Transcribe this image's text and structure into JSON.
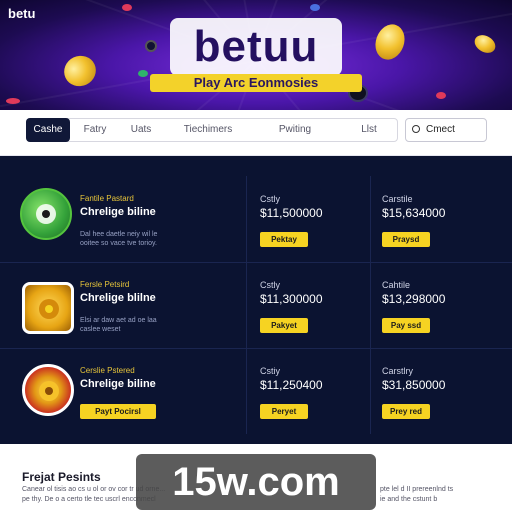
{
  "hero": {
    "corner_logo": "betu",
    "logo": "betuu",
    "tagline": "Play Arc Eonmosies"
  },
  "nav": {
    "tabs": [
      "Cashe",
      "Fatry",
      "Uats",
      "Tiechimers",
      "Pwiting",
      "Llst"
    ],
    "active_index": 0,
    "contact_label": "Cmect",
    "contact_icon": "search-icon"
  },
  "games": [
    {
      "icon": "frog-mascot-icon",
      "category": "Fantile Pastard",
      "title": "Chrelige biline",
      "description": "Dal hee daetle neiy wil le ooitee so vace tve torioy.",
      "stat1_label": "Cstly",
      "stat1_value": "$11,500000",
      "button1": "Pektay",
      "stat2_label": "Carstile",
      "stat2_value": "$15,634000",
      "button2": "Praysd"
    },
    {
      "icon": "gold-coin-emblem-icon",
      "category": "Fersle Petsird",
      "title": "Chrelige blilne",
      "description": "Elsi ar daw aet ad oe laa caslee weset",
      "stat1_label": "Cstly",
      "stat1_value": "$11,300000",
      "button1": "Pakyet",
      "stat2_label": "Cahtile",
      "stat2_value": "$13,298000",
      "button2": "Pay ssd"
    },
    {
      "icon": "red-coin-emblem-icon",
      "category": "Cerslie Pstered",
      "title": "Chrelige biline",
      "description": "",
      "wide_button": "Payt Pocirsl",
      "stat1_label": "Cstiy",
      "stat1_value": "$11,250400",
      "button1": "Peryet",
      "stat2_label": "Carstlry",
      "stat2_value": "$31,850000",
      "button2": "Prey red"
    }
  ],
  "footer": {
    "title": "Frejat Pesints",
    "line1": "Canear ol tisis ao cs u ol or ov cor tr ud orne...",
    "line2": "pe thy. De o a certo tle tec uscrl enconmecl",
    "line1_right": "pte lel d II prereenlnd ts",
    "line2_right": "ie and the cstunt b"
  },
  "watermark": "15w.com",
  "colors": {
    "hero_purple": "#4a16a8",
    "panel_navy": "#0b1331",
    "accent_yellow": "#f6d322",
    "nav_active": "#101838"
  }
}
